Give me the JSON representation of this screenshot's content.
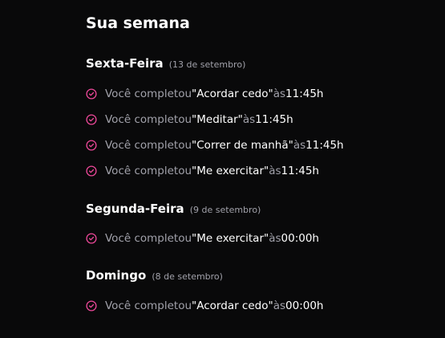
{
  "page_title": "Sua semana",
  "accent_color": "#ec4899",
  "days": [
    {
      "name": "Sexta-Feira",
      "date": "(13 de setembro)",
      "entries": [
        {
          "icon": "check-circle-icon",
          "prefix": "Você completou ",
          "habit": "\"Acordar cedo\"",
          "connector": " às ",
          "time": "11:45h"
        },
        {
          "icon": "check-circle-icon",
          "prefix": "Você completou ",
          "habit": "\"Meditar\"",
          "connector": " às ",
          "time": "11:45h"
        },
        {
          "icon": "check-circle-icon",
          "prefix": "Você completou ",
          "habit": "\"Correr de manhã\"",
          "connector": " às ",
          "time": "11:45h"
        },
        {
          "icon": "check-circle-icon",
          "prefix": "Você completou ",
          "habit": "\"Me exercitar\"",
          "connector": " às ",
          "time": "11:45h"
        }
      ]
    },
    {
      "name": "Segunda-Feira",
      "date": "(9 de setembro)",
      "entries": [
        {
          "icon": "check-circle-icon",
          "prefix": "Você completou ",
          "habit": "\"Me exercitar\"",
          "connector": " às ",
          "time": "00:00h"
        }
      ]
    },
    {
      "name": "Domingo",
      "date": "(8 de setembro)",
      "entries": [
        {
          "icon": "check-circle-icon",
          "prefix": "Você completou ",
          "habit": "\"Acordar cedo\"",
          "connector": " às ",
          "time": "00:00h"
        }
      ]
    }
  ]
}
